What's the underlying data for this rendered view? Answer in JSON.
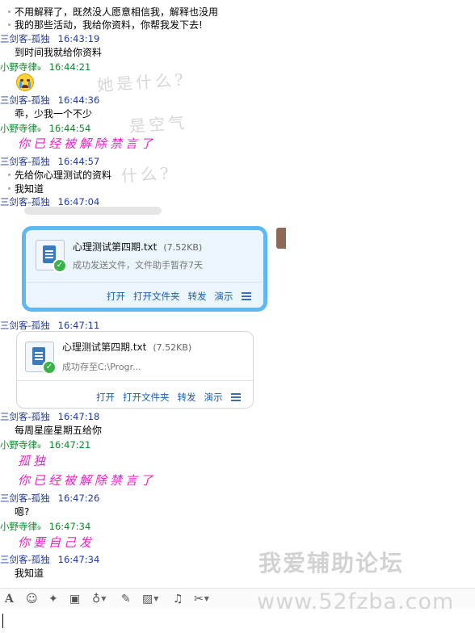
{
  "messages": {
    "m1": "不用解释了，既然没人愿意相信我，解释也没用",
    "m2": "我的那些活动，我给你资料，你帮我发下去!",
    "h1_name": "三剑客-孤独",
    "h1_time": "16:43:19",
    "m3": "到时间我就给你资料",
    "h2_name": "小野寺律₉",
    "h2_time": "16:44:21",
    "h3_name": "三剑客-孤独",
    "h3_time": "16:44:36",
    "m4": "乖，少我一个不少",
    "h4_name": "小野寺律₉",
    "h4_time": "16:44:54",
    "p1": "你已经被解除禁言了",
    "h5_name": "三剑客-孤独",
    "h5_time": "16:44:57",
    "m5": "先给你心理测试的资料",
    "m6": "我知道",
    "h6_name": "三剑客-孤独",
    "h6_time": "16:47:04",
    "h7_name": "三剑客-孤独",
    "h7_time": "16:47:11",
    "h8_name": "三剑客-孤独",
    "h8_time": "16:47:18",
    "m7": "每周星座星期五给你",
    "h9_name": "小野寺律₉",
    "h9_time": "16:47:21",
    "p2": "孤独",
    "p3": "你已经被解除禁言了",
    "h10_name": "三剑客-孤独",
    "h10_time": "16:47:26",
    "m8": "嗯?",
    "h11_name": "小野寺律₉",
    "h11_time": "16:47:34",
    "p4": "你要自己发",
    "h12_name": "三剑客-孤独",
    "h12_time": "16:47:34",
    "m9": "我知道"
  },
  "background_doodle": [
    "她是什么?",
    "是空气",
    "什么?"
  ],
  "file1": {
    "name": "心理测试第四期.txt",
    "size": "(7.52KB)",
    "status": "成功发送文件，文件助手暂存7天",
    "actions": [
      "打开",
      "打开文件夹",
      "转发",
      "演示"
    ]
  },
  "file2": {
    "name": "心理测试第四期.txt",
    "size": "(7.52KB)",
    "status": "成功存至C:\\Progr...",
    "actions": [
      "打开",
      "打开文件夹",
      "转发",
      "演示"
    ]
  },
  "watermark": {
    "brand": "我爱辅助论坛",
    "site": "www.52fzba.com"
  },
  "toolbar": [
    "font",
    "emoji",
    "magic",
    "video",
    "voice",
    "edit",
    "image",
    "music",
    "scissors"
  ],
  "colors": {
    "blue_name": "#1f3aa6",
    "green_name": "#0a8a2a",
    "pink_text": "#ee20c8",
    "file_border": "#5fb8ef"
  }
}
